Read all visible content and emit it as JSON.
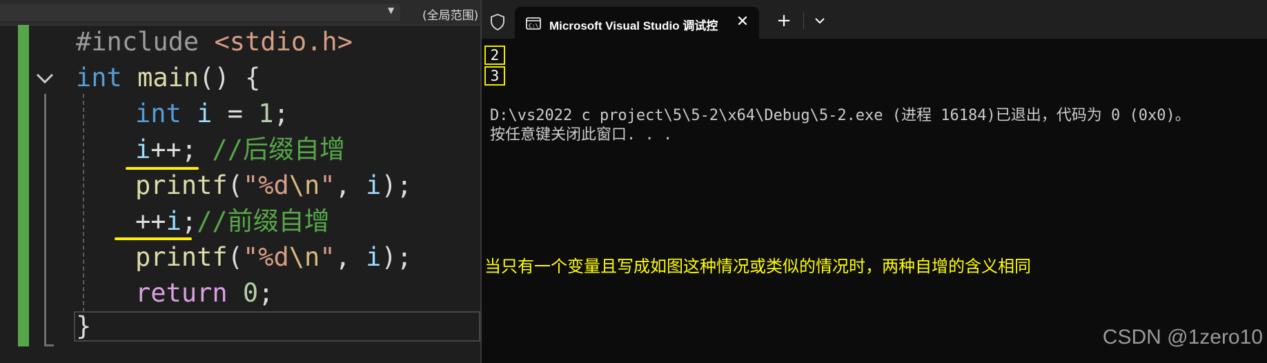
{
  "editor": {
    "nav_scope": "(全局范围)",
    "lines": [
      {
        "include_directive": "#include",
        "include_file": " <stdio.h>"
      },
      {
        "kw": "int",
        "name": " main",
        "rest": "() {"
      },
      {
        "kw": "int",
        "var": " i",
        "op": " = ",
        "num": "1",
        "semi": ";"
      },
      {
        "var": "i",
        "op": "++",
        "semi": ";",
        "comment": " //后缀自增"
      },
      {
        "fn": "printf",
        "open": "(",
        "str": "\"%d",
        "esc": "\\n",
        "str_end": "\"",
        "sep": ", ",
        "var": "i",
        "close": ");"
      },
      {
        "op": "++",
        "var": "i",
        "semi": ";",
        "comment": "//前缀自增"
      },
      {
        "fn": "printf",
        "open": "(",
        "str": "\"%d",
        "esc": "\\n",
        "str_end": "\"",
        "sep": ", ",
        "var": "i",
        "close": ");"
      },
      {
        "kw": "return",
        "num": " 0",
        "semi": ";"
      },
      {
        "brace": "}"
      }
    ]
  },
  "terminal": {
    "tab_title": "Microsoft Visual Studio 调试控",
    "close_glyph": "✕",
    "new_tab_glyph": "+",
    "outputs": [
      "2",
      "3"
    ],
    "exit_line": "D:\\vs2022 c project\\5\\5-2\\x64\\Debug\\5-2.exe (进程 16184)已退出，代码为 0 (0x0)。",
    "close_prompt": "按任意键关闭此窗口. . .",
    "annotation": "当只有一个变量且写成如图这种情况或类似的情况时，两种自增的含义相同",
    "watermark": "CSDN @1zero10"
  },
  "colors": {
    "change_bar": "#57a64a",
    "highlight": "#ffef00",
    "annotation": "#ffff00"
  },
  "icons": [
    "shield-icon",
    "terminal-icon",
    "close-icon",
    "plus-icon",
    "chevron-down-icon",
    "fold-chevron-icon"
  ]
}
